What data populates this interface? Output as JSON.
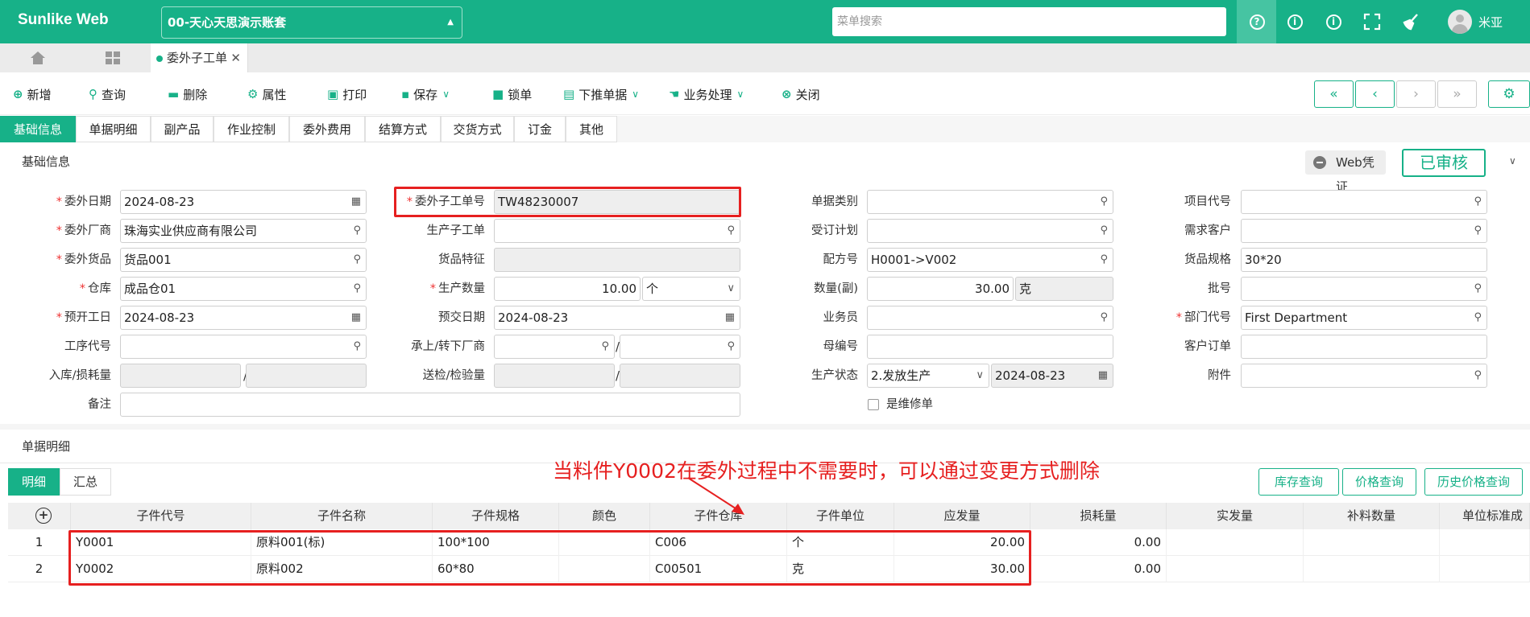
{
  "header": {
    "app_name": "Sunlike Web",
    "account": "00-天心天思演示账套",
    "search_placeholder": "菜单搜索",
    "user": "米亚"
  },
  "open_tab": "委外子工单",
  "toolbar": {
    "new": "新增",
    "query": "查询",
    "delete": "删除",
    "props": "属性",
    "print": "打印",
    "save": "保存",
    "lock": "锁单",
    "push": "下推单据",
    "business": "业务处理",
    "close": "关闭"
  },
  "tabs": [
    "基础信息",
    "单据明细",
    "副产品",
    "作业控制",
    "委外费用",
    "结算方式",
    "交货方式",
    "订金",
    "其他"
  ],
  "basic": {
    "section_title": "基础信息",
    "web_voucher": "Web凭证",
    "status": "已审核"
  },
  "form": {
    "c1": [
      {
        "label": "委外日期",
        "value": "2024-08-23",
        "req": true
      },
      {
        "label": "委外厂商",
        "value": "珠海实业供应商有限公司",
        "req": true
      },
      {
        "label": "委外货品",
        "value": "货品001",
        "req": true
      },
      {
        "label": "仓库",
        "value": "成品仓01",
        "req": true
      },
      {
        "label": "预开工日",
        "value": "2024-08-23",
        "req": true
      },
      {
        "label": "工序代号",
        "value": ""
      },
      {
        "label": "入库/损耗量",
        "value": ""
      },
      {
        "label": "备注",
        "value": ""
      }
    ],
    "c2": [
      {
        "label": "委外子工单号",
        "value": "TW48230007",
        "req": true
      },
      {
        "label": "生产子工单",
        "value": ""
      },
      {
        "label": "货品特征",
        "value": ""
      },
      {
        "label": "生产数量",
        "value": "10.00",
        "unit": "个",
        "req": true
      },
      {
        "label": "预交日期",
        "value": "2024-08-23"
      },
      {
        "label": "承上/转下厂商",
        "value": ""
      },
      {
        "label": "送检/检验量",
        "value": ""
      }
    ],
    "c3": [
      {
        "label": "单据类别",
        "value": ""
      },
      {
        "label": "受订计划",
        "value": ""
      },
      {
        "label": "配方号",
        "value": "H0001->V002"
      },
      {
        "label": "数量(副)",
        "value": "30.00",
        "unit": "克"
      },
      {
        "label": "业务员",
        "value": ""
      },
      {
        "label": "母编号",
        "value": ""
      },
      {
        "label": "生产状态",
        "value": "2.发放生产",
        "date": "2024-08-23"
      },
      {
        "label": "是维修单",
        "value": ""
      }
    ],
    "c4": [
      {
        "label": "项目代号",
        "value": ""
      },
      {
        "label": "需求客户",
        "value": ""
      },
      {
        "label": "货品规格",
        "value": "30*20"
      },
      {
        "label": "批号",
        "value": ""
      },
      {
        "label": "部门代号",
        "value": "First Department",
        "req": true
      },
      {
        "label": "客户订单",
        "value": ""
      },
      {
        "label": "附件",
        "value": ""
      }
    ]
  },
  "detail": {
    "section_title": "单据明细",
    "tab_detail": "明细",
    "tab_summary": "汇总",
    "btn_stock": "库存查询",
    "btn_price": "价格查询",
    "btn_history": "历史价格查询",
    "columns": [
      "子件代号",
      "子件名称",
      "子件规格",
      "颜色",
      "子件仓库",
      "子件单位",
      "应发量",
      "损耗量",
      "实发量",
      "补料数量",
      "单位标准成"
    ],
    "rows": [
      {
        "no": "1",
        "code": "Y0001",
        "name": "原料001(标)",
        "spec": "100*100",
        "color": "",
        "wh": "C006",
        "unit": "个",
        "qty": "20.00",
        "loss": "0.00"
      },
      {
        "no": "2",
        "code": "Y0002",
        "name": "原料002",
        "spec": "60*80",
        "color": "",
        "wh": "C00501",
        "unit": "克",
        "qty": "30.00",
        "loss": "0.00"
      }
    ]
  },
  "annotation": "当料件Y0002在委外过程中不需要时，可以通过变更方式删除",
  "colors": {
    "brand": "#17b188",
    "annotation": "#e62020"
  }
}
